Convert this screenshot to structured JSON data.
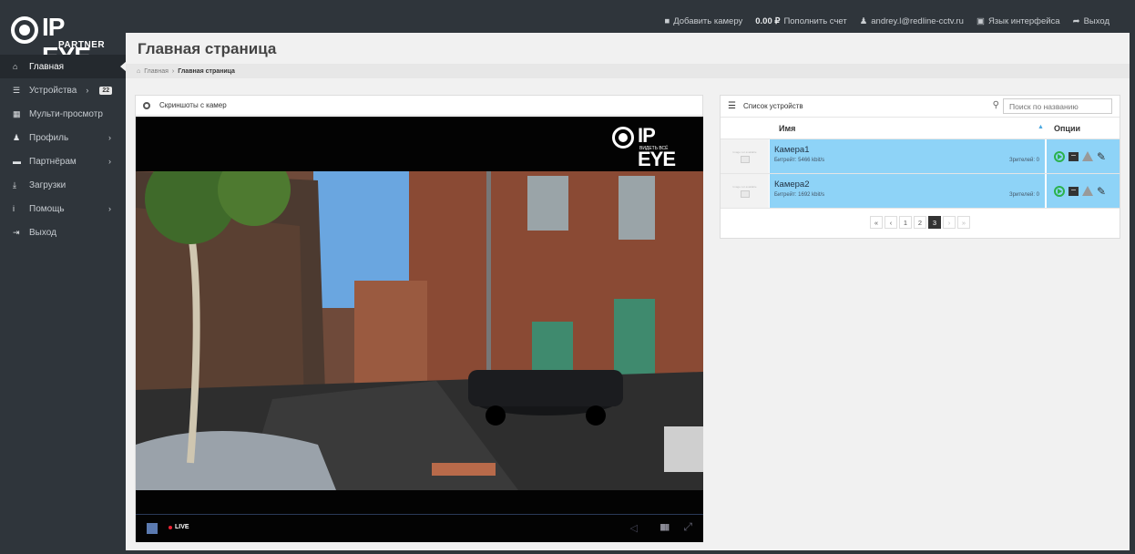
{
  "brand": {
    "logo_text": "IP EYE",
    "logo_sub": "PARTNER"
  },
  "topbar": {
    "add_camera": "Добавить камеру",
    "balance": "0.00 ₽",
    "top_up": "Пополнить счет",
    "user": "andrey.l@redline-cctv.ru",
    "language": "Язык интерфейса",
    "logout": "Выход"
  },
  "sidebar": {
    "items": [
      {
        "label": "Главная",
        "icon": "home-icon"
      },
      {
        "label": "Устройства",
        "icon": "list-icon",
        "badge": "22"
      },
      {
        "label": "Мульти-просмотр",
        "icon": "grid-icon"
      },
      {
        "label": "Профиль",
        "icon": "user-icon"
      },
      {
        "label": "Партнёрам",
        "icon": "briefcase-icon"
      },
      {
        "label": "Загрузки",
        "icon": "download-icon"
      },
      {
        "label": "Помощь",
        "icon": "info-icon"
      },
      {
        "label": "Выход",
        "icon": "logout-icon"
      }
    ]
  },
  "page": {
    "title": "Главная страница",
    "breadcrumb": {
      "home": "Главная",
      "current": "Главная страница"
    }
  },
  "screenshots": {
    "title": "Скриншоты с камер",
    "video_logo": "IP EYE",
    "video_slogan": "ВИДЕТЬ ВСЁ",
    "live_label": "LIVE"
  },
  "devices": {
    "title": "Список устройств",
    "search_placeholder": "Поиск по названию",
    "col_name": "Имя",
    "col_options": "Опции",
    "rows": [
      {
        "name": "Камера1",
        "bitrate": "Битрейт: 5466 kbit/s",
        "viewers": "Зрителей: 0",
        "thumb": "Image not available"
      },
      {
        "name": "Камера2",
        "bitrate": "Битрейт: 1692 kbit/s",
        "viewers": "Зрителей: 0",
        "thumb": "Image not available"
      }
    ],
    "pagination": {
      "first": "«",
      "prev": "‹",
      "pages": [
        "1",
        "2",
        "3"
      ],
      "active_page": "3",
      "next": "›",
      "last": "»"
    }
  },
  "colors": {
    "sidebar": "#2f353b",
    "row_highlight": "#8ed3f7",
    "play": "#2bb24c"
  }
}
